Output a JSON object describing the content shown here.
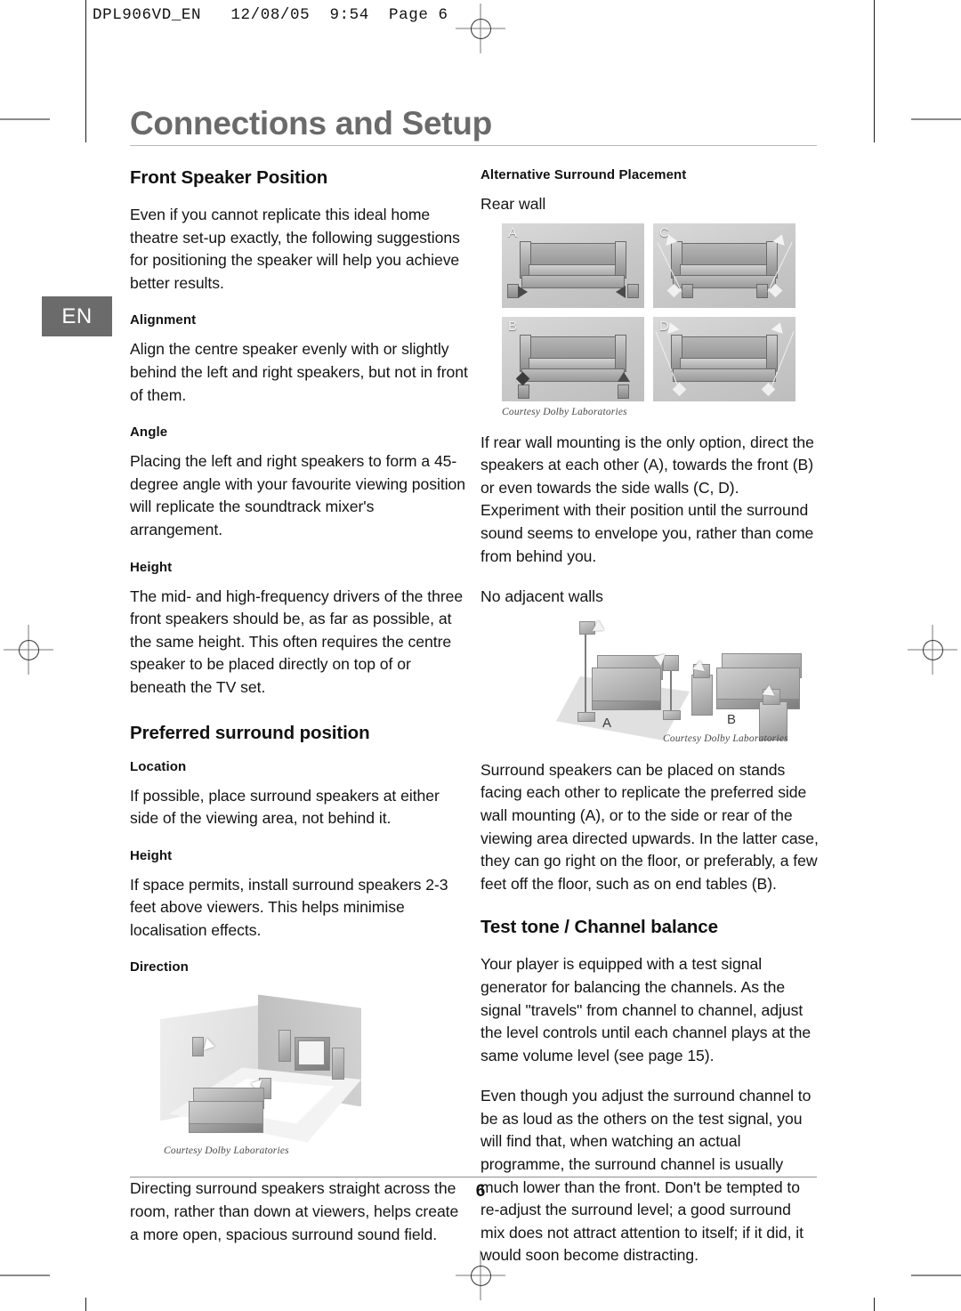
{
  "printer_slug": "DPL906VD_EN   12/08/05  9:54  Page 6",
  "page": {
    "title": "Connections and Setup",
    "language_tab": "EN",
    "page_number": "6"
  },
  "left_column": {
    "heading_front": "Front Speaker Position",
    "intro": "Even if you cannot replicate this ideal home theatre set-up exactly, the following suggestions for positioning the speaker will help you achieve better results.",
    "alignment_label": "Alignment",
    "alignment_text": "Align the centre speaker evenly with or slightly behind the left and right speakers, but not in front of them.",
    "angle_label": "Angle",
    "angle_text": "Placing the left and right speakers to form a 45-degree angle with your favourite viewing position will replicate the soundtrack mixer's arrangement.",
    "height_label": "Height",
    "height_text": "The mid- and high-frequency drivers of the three front speakers should be, as far as possible, at the same height. This often requires the centre speaker to be placed directly on top of or beneath the TV set.",
    "heading_surround": "Preferred surround position",
    "location_label": "Location",
    "location_text": "If possible, place surround speakers at either side of the viewing area, not behind it.",
    "surround_height_label": "Height",
    "surround_height_text": "If space permits, install surround speakers 2-3 feet above viewers. This helps minimise localisation effects.",
    "direction_label": "Direction",
    "direction_caption": "Courtesy Dolby Laboratories",
    "direction_text": "Directing surround speakers straight across the room, rather than down at viewers, helps create a more open, spacious surround sound field."
  },
  "right_column": {
    "alt_placement_label": "Alternative Surround Placement",
    "rear_wall_label": "Rear wall",
    "rear_wall_panels": [
      "A",
      "C",
      "B",
      "D"
    ],
    "rear_wall_caption": "Courtesy Dolby Laboratories",
    "rear_wall_text": "If rear wall mounting is the only option, direct the speakers at each other (A), towards the front (B) or even towards the side walls (C, D). Experiment with their position until the surround sound seems to envelope you, rather than come from behind you.",
    "no_adjacent_label": "No adjacent walls",
    "stand_labels": [
      "A",
      "B"
    ],
    "stands_caption": "Courtesy Dolby Laboratories",
    "stands_text": "Surround speakers can be placed on stands facing each other to replicate the preferred side wall mounting (A), or to the side or rear of the viewing area directed upwards. In the latter case, they can go right on the floor, or preferably, a few feet off the floor, such as on end tables (B).",
    "heading_test_tone": "Test tone / Channel balance",
    "test_tone_p1": "Your player is equipped with a test signal generator for balancing the channels. As the signal \"travels\" from channel to channel, adjust the level controls until each channel plays at the same volume level (see page 15).",
    "test_tone_p2": "Even though you adjust the surround channel to be as loud as the others on the test signal, you will find that, when watching an actual programme, the surround channel is usually much lower than the front. Don't be tempted to re-adjust the surround level; a good surround mix does not attract attention to itself; if it did, it would soon become distracting."
  },
  "colors": {
    "title_gray": "#6a6a6a",
    "tab_gray": "#6b6b6b",
    "text_black": "#141414"
  }
}
